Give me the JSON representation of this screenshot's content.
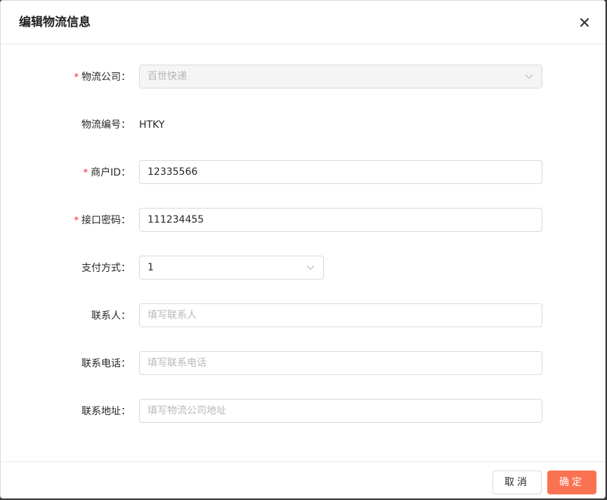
{
  "dialog": {
    "title": "编辑物流信息",
    "close_icon": "close-icon"
  },
  "form": {
    "logistics_company": {
      "label": "物流公司",
      "required": true,
      "value": "百世快递",
      "disabled": true
    },
    "logistics_code": {
      "label": "物流编号",
      "value": "HTKY"
    },
    "merchant_id": {
      "label": "商户ID",
      "required": true,
      "value": "12335566"
    },
    "api_password": {
      "label": "接口密码",
      "required": true,
      "value": "111234455"
    },
    "payment_method": {
      "label": "支付方式",
      "value": "1"
    },
    "contact": {
      "label": "联系人",
      "placeholder": "填写联系人"
    },
    "phone": {
      "label": "联系电话",
      "placeholder": "填写联系电话"
    },
    "address": {
      "label": "联系地址",
      "placeholder": "填写物流公司地址"
    },
    "colon": "："
  },
  "footer": {
    "cancel_label": "取消",
    "ok_label": "确定"
  },
  "colors": {
    "primary": "#fb7252",
    "required": "#f5222d"
  }
}
